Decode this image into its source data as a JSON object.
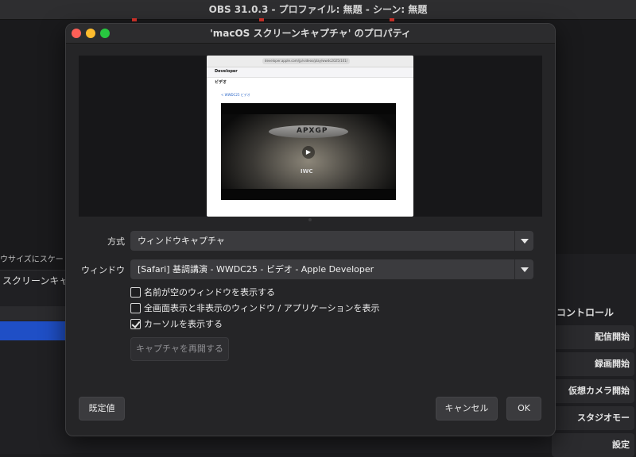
{
  "app_title": "OBS 31.0.3 - プロファイル: 無題 - シーン: 無題",
  "background": {
    "hint_text": "ウサイズにスケーリン",
    "scene_title": "スクリーンキャプチ",
    "controls_title": "コントロール",
    "controls": [
      "配信開始",
      "録画開始",
      "仮想カメラ開始",
      "スタジオモー",
      "設定"
    ],
    "colors": {
      "selection": "#1f4fc6",
      "record_marker": "#d9342b"
    }
  },
  "dialog": {
    "title": "'macOS スクリーンキャプチャ' のプロパティ",
    "preview": {
      "icon": "captured-window-preview",
      "address": "developer.apple.com/jp/videos/play/wwdc2025/101/",
      "brand": "Developer",
      "subhead": "ビデオ",
      "link": "< WWDC25 ビデオ",
      "visor_text": "APXGP",
      "watch_brand": "IWC"
    },
    "method_label": "方式",
    "method_value": "ウィンドウキャプチャ",
    "window_label": "ウィンドウ",
    "window_value": "[Safari] 基調講演 - WWDC25 - ビデオ - Apple Developer",
    "checkboxes": [
      {
        "label": "名前が空のウィンドウを表示する",
        "checked": false
      },
      {
        "label": "全画面表示と非表示のウィンドウ / アプリケーションを表示",
        "checked": false
      },
      {
        "label": "カーソルを表示する",
        "checked": true
      }
    ],
    "restart_button": "キャプチャを再開する",
    "defaults_button": "既定値",
    "cancel_button": "キャンセル",
    "ok_button": "OK"
  }
}
